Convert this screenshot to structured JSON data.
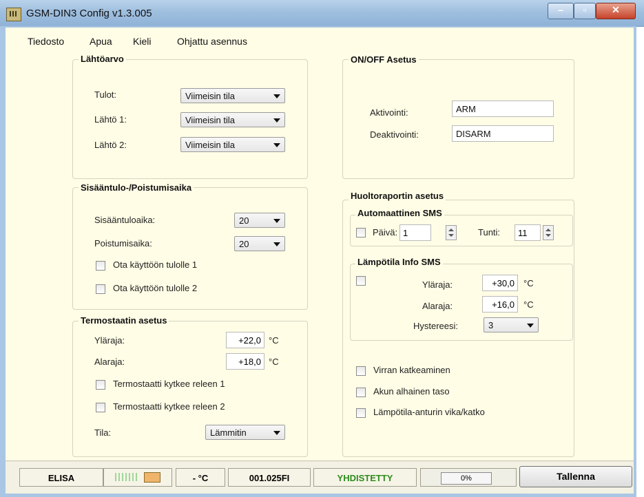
{
  "window": {
    "title": "GSM-DIN3 Config v1.3.005"
  },
  "menu": [
    "Tiedosto",
    "Apua",
    "Kieli",
    "Ohjattu asennus"
  ],
  "lahtoarvo": {
    "title": "Lähtöarvo",
    "rows": [
      {
        "label": "Tulot:",
        "value": "Viimeisin tila"
      },
      {
        "label": "Lähtö 1:",
        "value": "Viimeisin tila"
      },
      {
        "label": "Lähtö 2:",
        "value": "Viimeisin tila"
      }
    ]
  },
  "sisaantulo": {
    "title": "Sisääntulo-/Poistumisaika",
    "entry_label": "Sisääntuloaika:",
    "entry_value": "20",
    "exit_label": "Poistumisaika:",
    "exit_value": "20",
    "check1": "Ota käyttöön tulolle 1",
    "check2": "Ota käyttöön tulolle 2"
  },
  "termostaatti": {
    "title": "Termostaatin asetus",
    "upper_label": "Yläraja:",
    "upper_value": "+22,0",
    "upper_unit": "°C",
    "lower_label": "Alaraja:",
    "lower_value": "+18,0",
    "lower_unit": "°C",
    "check1": "Termostaatti kytkee releen 1",
    "check2": "Termostaatti kytkee releen 2",
    "mode_label": "Tila:",
    "mode_value": "Lämmitin"
  },
  "onoff": {
    "title": "ON/OFF Asetus",
    "activate_label": "Aktivointi:",
    "activate_value": "ARM",
    "deactivate_label": "Deaktivointi:",
    "deactivate_value": "DISARM"
  },
  "huolto": {
    "title": "Huoltoraportin asetus",
    "auto_title": "Automaattinen SMS",
    "day_label": "Päivä:",
    "day_value": "1",
    "hour_label": "Tunti:",
    "hour_value": "11",
    "temp_title": "Lämpötila Info SMS",
    "upper_label": "Yläraja:",
    "upper_value": "+30,0",
    "upper_unit": "°C",
    "lower_label": "Alaraja:",
    "lower_value": "+16,0",
    "lower_unit": "°C",
    "hyst_label": "Hystereesi:",
    "hyst_value": "3",
    "alarms": [
      "Virran katkeaminen",
      "Akun alhainen taso",
      "Lämpötila-anturin vika/katko"
    ]
  },
  "status": {
    "operator": "ELISA",
    "temperature": "- °C",
    "version": "001.025FI",
    "connection": "YHDISTETTY",
    "connection_color": "#2e8b1e",
    "progress": "0%",
    "save_label": "Tallenna"
  }
}
